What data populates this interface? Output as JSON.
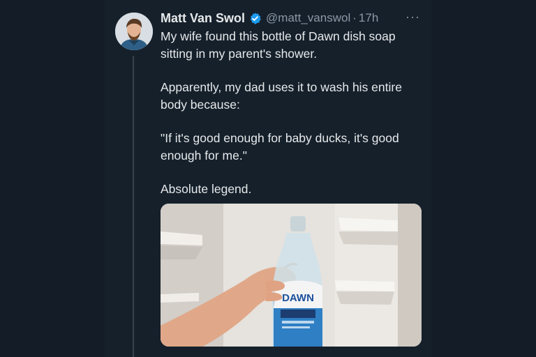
{
  "author": {
    "display_name": "Matt Van Swol",
    "handle": "@matt_vanswol",
    "separator": "·",
    "time": "17h",
    "verified": true
  },
  "more_label": "···",
  "text": {
    "p1": "My wife found this bottle of Dawn dish soap sitting in my parent's shower.",
    "p2": "Apparently, my dad uses it to wash his entire body because:",
    "p3": "\"If it's good enough for baby ducks, it's good enough for me.\"",
    "p4": "Absolute legend."
  },
  "media": {
    "bottle_brand": "DAWN"
  },
  "colors": {
    "background": "#15202b",
    "text": "#e7e9ea",
    "muted": "#8b98a5",
    "verified": "#1d9bf0"
  }
}
